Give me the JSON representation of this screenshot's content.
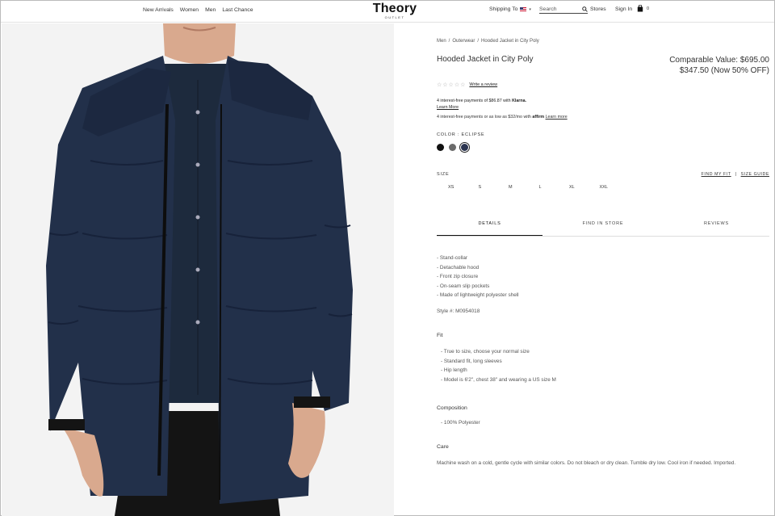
{
  "header": {
    "nav": [
      "New Arrivals",
      "Women",
      "Men",
      "Last Chance"
    ],
    "logo": "Theory",
    "logo_sub": "OUTLET",
    "shipping_label": "Shipping To",
    "search_placeholder": "Search",
    "stores": "Stores",
    "sign_in": "Sign In",
    "bag_count": "0"
  },
  "breadcrumb": [
    "Men",
    "Outerwear",
    "Hooded Jacket in City Poly"
  ],
  "product": {
    "title": "Hooded Jacket in City Poly",
    "comparable": "Comparable Value: $695.00",
    "price": "$347.50 (Now 50% OFF)",
    "stars": "☆☆☆☆☆",
    "write_review": "Write a review",
    "klarna_text": "4 interest-free payments of $86.87 with",
    "klarna_brand": "Klarna.",
    "klarna_learn": "Learn More",
    "affirm_text": "4 interest-free payments or as low as $32/mo with",
    "affirm_brand": "affirm",
    "affirm_learn": "Learn more",
    "color_label": "COLOR :  ECLIPSE",
    "colors": [
      "#111111",
      "#6b6b6b",
      "#2c3550"
    ],
    "size_label": "SIZE",
    "find_my_fit": "FIND MY FIT",
    "size_guide": "SIZE GUIDE",
    "sizes": [
      "XS",
      "S",
      "M",
      "L",
      "XL",
      "XXL"
    ]
  },
  "tabs": [
    "DETAILS",
    "FIND IN STORE",
    "REVIEWS"
  ],
  "details": {
    "features": [
      "- Stand-collar",
      "- Detachable hood",
      "- Front zip closure",
      "- On-seam slip pockets",
      "- Made of lightweight polyester shell"
    ],
    "style": "Style #: M0954018",
    "fit_heading": "Fit",
    "fit": [
      "- True to size, choose your normal size",
      "- Standard fit, long sleeves",
      "- Hip length",
      "- Model is 6'2\", chest 38\" and wearing a US size M"
    ],
    "composition_heading": "Composition",
    "composition": [
      "- 100% Polyester"
    ],
    "care_heading": "Care",
    "care": "Machine wash on a cold, gentle cycle with similar colors. Do not bleach or dry clean. Tumble dry low. Cool iron if needed. Imported."
  }
}
